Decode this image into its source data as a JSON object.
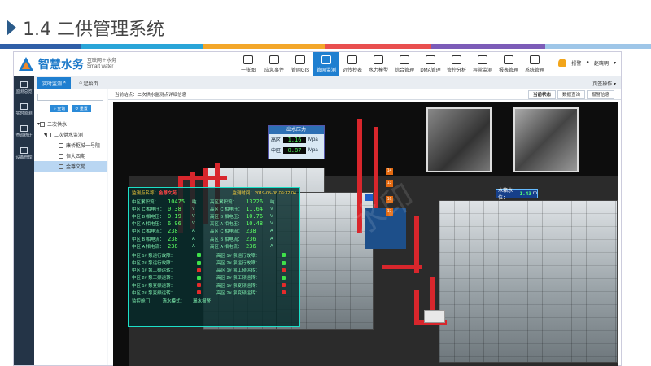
{
  "slide": {
    "title": "1.4 二供管理系统"
  },
  "colors": {
    "band": [
      "#2f5fa8",
      "#2aa5d8",
      "#f3a72a",
      "#e94f4f",
      "#7c5cb8",
      "#9ec6e8"
    ]
  },
  "app": {
    "logo": {
      "name": "智慧水务",
      "sub1": "互联网＋水务",
      "sub2": "Smart water"
    },
    "nav": [
      {
        "label": "一张图",
        "icon": "map-icon"
      },
      {
        "label": "应急事件",
        "icon": "alert-icon"
      },
      {
        "label": "管网GIS",
        "icon": "gis-icon"
      },
      {
        "label": "管网监测",
        "icon": "monitor-icon",
        "active": true
      },
      {
        "label": "远传抄表",
        "icon": "meter-icon"
      },
      {
        "label": "水力模型",
        "icon": "model-icon"
      },
      {
        "label": "综合管理",
        "icon": "grid-icon"
      },
      {
        "label": "DMA管理",
        "icon": "dma-icon"
      },
      {
        "label": "管控分析",
        "icon": "analysis-icon"
      },
      {
        "label": "异常监测",
        "icon": "anomaly-icon"
      },
      {
        "label": "报表管理",
        "icon": "report-icon"
      },
      {
        "label": "系统管理",
        "icon": "settings-icon"
      }
    ],
    "alarm_label": "报警",
    "user_label": "赵晓明",
    "sidebar": [
      "监测总览",
      "实时监测",
      "查询统计",
      "设备管理"
    ],
    "tabs": {
      "active": "实时监测",
      "other": "起始页",
      "right": "页签操作"
    },
    "tree": {
      "btn_search": "查询",
      "btn_reset": "重置",
      "nodes": [
        "二次供水",
        "二次供水监测",
        "康桥枢城一号院",
        "恒大四期",
        "金尊文苑"
      ]
    },
    "main": {
      "breadcrumb": "当前站点：二次供水监测点详细信息",
      "tabs": [
        "当前状态",
        "数据查询",
        "报警信息"
      ]
    },
    "pressure": {
      "title": "出水压力",
      "rows": [
        {
          "label": "高区",
          "value": "1.16",
          "unit": "Mpa"
        },
        {
          "label": "中区",
          "value": "0.87",
          "unit": "Mpa"
        }
      ]
    },
    "tank_level": {
      "label": "水箱水位：",
      "value": "1.43",
      "unit": "m"
    },
    "info": {
      "site_label": "监测点名称：",
      "site_name": "金尊文苑",
      "time_label": "监测时间：",
      "time": "2019-05-08 09:32:04",
      "left_rows": [
        {
          "label": "中区累积流：",
          "value": "10475",
          "unit": "吨"
        },
        {
          "label": "中区 C 相电压：",
          "value": "0.38",
          "unit": "V"
        },
        {
          "label": "中区 B 相电压：",
          "value": "0.19",
          "unit": "V"
        },
        {
          "label": "中区 A 相电压：",
          "value": "6.96",
          "unit": "V"
        },
        {
          "label": "中区 C 相电流：",
          "value": "238",
          "unit": "A"
        },
        {
          "label": "中区 B 相电流：",
          "value": "238",
          "unit": "A"
        },
        {
          "label": "中区 A 相电流：",
          "value": "238",
          "unit": "A"
        }
      ],
      "right_rows": [
        {
          "label": "高区累积流：",
          "value": "13226",
          "unit": "吨"
        },
        {
          "label": "高区 C 相电压：",
          "value": "11.64",
          "unit": "V"
        },
        {
          "label": "高区 B 相电压：",
          "value": "10.76",
          "unit": "V"
        },
        {
          "label": "高区 A 相电压：",
          "value": "10.48",
          "unit": "V"
        },
        {
          "label": "高区 C 相电流：",
          "value": "238",
          "unit": "A"
        },
        {
          "label": "高区 B 相电流：",
          "value": "236",
          "unit": "A"
        },
        {
          "label": "高区 A 相电流：",
          "value": "236",
          "unit": "A"
        }
      ],
      "left_status": [
        {
          "label": "中区 1# 泵运行故障：",
          "state": "green"
        },
        {
          "label": "中区 2# 泵运行故障：",
          "state": "green"
        },
        {
          "label": "中区 1# 泵工频运转：",
          "state": "red"
        },
        {
          "label": "中区 2# 泵工频运转：",
          "state": "green"
        },
        {
          "label": "中区 1# 泵变频运转：",
          "state": "red"
        },
        {
          "label": "中区 2# 泵变频运转：",
          "state": "red"
        }
      ],
      "right_status": [
        {
          "label": "高区 1# 泵运行故障：",
          "state": "green"
        },
        {
          "label": "高区 2# 泵运行故障：",
          "state": "green"
        },
        {
          "label": "高区 1# 泵工频运转：",
          "state": "red"
        },
        {
          "label": "高区 2# 泵工频运转：",
          "state": "green"
        },
        {
          "label": "高区 1# 泵变频运转：",
          "state": "red"
        },
        {
          "label": "高区 2# 泵变频运转：",
          "state": "red"
        }
      ],
      "footer": [
        "监控舱门：",
        "清水模式：",
        "漏水报警："
      ]
    },
    "watermark": "水印"
  }
}
